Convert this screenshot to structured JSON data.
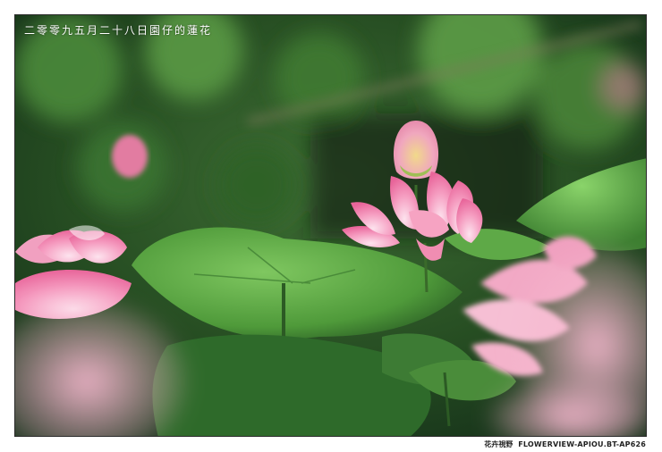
{
  "caption": "二零零九五月二十八日園仔的蓮花",
  "watermark": {
    "brand": "花卉視野",
    "url": "FLOWERVIEW-APIOU.BT-AP626"
  },
  "colors": {
    "frame": "#ffffff",
    "border": "#2b2b2b",
    "leaf_light": "#7fc760",
    "leaf_mid": "#4f9a3a",
    "leaf_dark": "#1f4a1c",
    "petal_pink": "#f07aa8",
    "petal_light": "#f8c1d6",
    "bud_yellow": "#e8d27a",
    "stem": "#3a6a2a"
  },
  "icons": [
    "lotus-flower",
    "lotus-bud",
    "lotus-leaf"
  ]
}
